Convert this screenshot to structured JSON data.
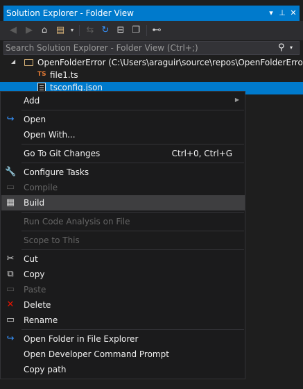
{
  "window": {
    "title": "Solution Explorer - Folder View",
    "dropdown_glyph": "▾",
    "pin_glyph": "⊥",
    "close_glyph": "✕"
  },
  "toolbar": {
    "back_glyph": "◀",
    "forward_glyph": "▶",
    "home_glyph": "⌂",
    "switch_views_glyph": "▤",
    "dropdown_glyph": "▾",
    "sync_glyph": "⇆",
    "refresh_glyph": "↻",
    "collapse_glyph": "⊟",
    "show_all_glyph": "❐",
    "properties_glyph": "⊷"
  },
  "search": {
    "placeholder": "Search Solution Explorer - Folder View (Ctrl+;)",
    "search_glyph": "⚲",
    "dropdown_glyph": "▾"
  },
  "tree": {
    "root_label": "OpenFolderError (C:\\Users\\araguir\\source\\repos\\OpenFolderError)",
    "root_expander": "◢",
    "file1_label": "file1.ts",
    "file1_badge": "TS",
    "file2_label": "tsconfig.json"
  },
  "menu": {
    "add": "Add",
    "add_arrow": "▶",
    "open": "Open",
    "open_with": "Open With...",
    "go_to_git": "Go To Git Changes",
    "go_to_git_shortcut": "Ctrl+0, Ctrl+G",
    "configure_tasks": "Configure Tasks",
    "compile": "Compile",
    "build": "Build",
    "run_code_analysis": "Run Code Analysis on File",
    "scope_to_this": "Scope to This",
    "cut": "Cut",
    "copy": "Copy",
    "paste": "Paste",
    "delete": "Delete",
    "rename": "Rename",
    "open_folder_explorer": "Open Folder in File Explorer",
    "open_dev_prompt": "Open Developer Command Prompt",
    "copy_path": "Copy path"
  },
  "icons": {
    "open": "↪",
    "configure": "🔧",
    "compile": "▭",
    "build": "▦",
    "cut": "✂",
    "copy": "⧉",
    "paste": "▭",
    "delete": "✕",
    "rename": "▭",
    "open_folder": "↪"
  },
  "colors": {
    "accent": "#007acc",
    "background": "#1e1e1e",
    "menu_background": "#1b1b1c",
    "hover": "#3e3e40",
    "delete_icon": "#e51400",
    "open_icon": "#3794ff",
    "folder_icon": "#dcb67a",
    "ts_badge": "#e37933"
  }
}
